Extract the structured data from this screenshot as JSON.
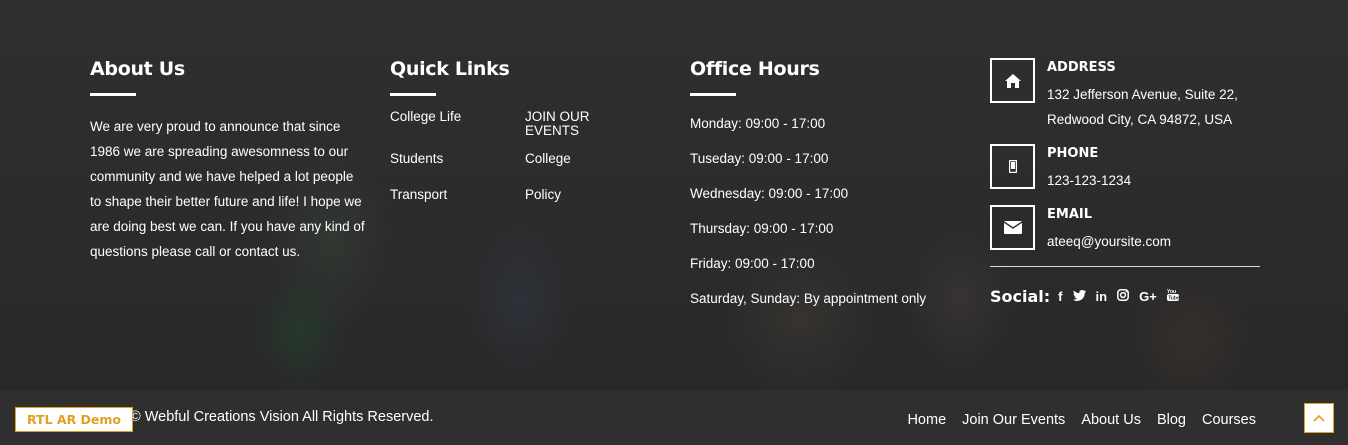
{
  "about": {
    "title": "About Us",
    "text": "We are very proud to announce that since 1986 we are spreading awesomness to our community and we have helped a lot people to shape their better future and life! I hope we are doing best we can. If you have any kind of questions please call or contact us."
  },
  "quick_links": {
    "title": "Quick Links",
    "items": [
      "College Life",
      "JOIN OUR EVENTS",
      "Students",
      "College",
      "Transport",
      "Policy"
    ]
  },
  "office_hours": {
    "title": "Office Hours",
    "items": [
      "Monday: 09:00 - 17:00",
      "Tuseday: 09:00 - 17:00",
      "Wednesday: 09:00 - 17:00",
      "Thursday: 09:00 - 17:00",
      "Friday: 09:00 - 17:00",
      "Saturday, Sunday: By appointment only"
    ]
  },
  "contact": {
    "address_label": "ADDRESS",
    "address_line1": "132 Jefferson Avenue, Suite 22,",
    "address_line2": "Redwood City, CA 94872, USA",
    "phone_label": "PHONE",
    "phone": "123-123-1234",
    "email_label": "EMAIL",
    "email": "ateeq@yoursite.com",
    "icons": [
      "home-icon",
      "mobile-icon",
      "envelope-icon"
    ]
  },
  "social": {
    "label": "Social:",
    "items": [
      {
        "icon": "facebook-icon",
        "glyph": "f"
      },
      {
        "icon": "twitter-icon",
        "glyph": "🐦"
      },
      {
        "icon": "linkedin-icon",
        "glyph": "in"
      },
      {
        "icon": "instagram-icon",
        "glyph": "◎"
      },
      {
        "icon": "google-plus-icon",
        "glyph": "G+"
      },
      {
        "icon": "youtube-icon",
        "glyph": "▶"
      }
    ]
  },
  "footer": {
    "badge": "RTL AR Demo",
    "copyright": "© Webful Creations Vision All Rights Reserved.",
    "nav": [
      "Home",
      "Join Our Events",
      "About Us",
      "Blog",
      "Courses"
    ],
    "accent": "#e0a020"
  }
}
